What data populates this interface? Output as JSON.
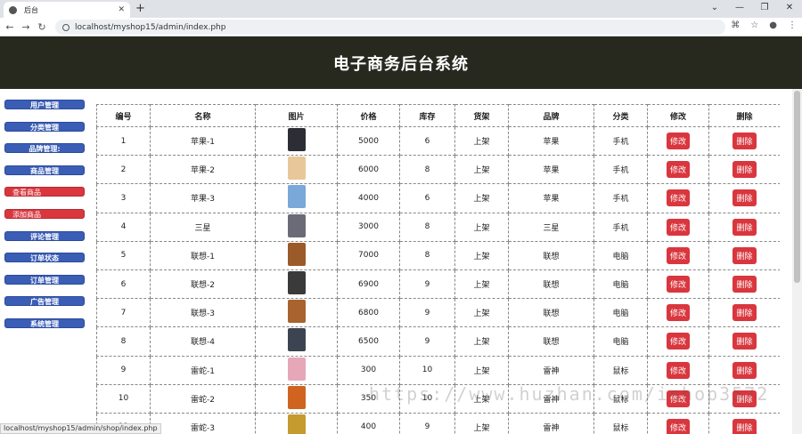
{
  "browser": {
    "tab_title": "后台",
    "url": "localhost/myshop15/admin/index.php",
    "status_url": "localhost/myshop15/admin/shop/index.php"
  },
  "header": {
    "title": "电子商务后台系统"
  },
  "sidebar": {
    "items": [
      {
        "label": "用户管理",
        "type": "main"
      },
      {
        "label": "分类管理",
        "type": "main"
      },
      {
        "label": "品牌管理:",
        "type": "main"
      },
      {
        "label": "商品管理",
        "type": "main"
      },
      {
        "label": "查看商品",
        "type": "sub"
      },
      {
        "label": "添加商品",
        "type": "sub"
      },
      {
        "label": "评论管理",
        "type": "main"
      },
      {
        "label": "订单状态",
        "type": "main"
      },
      {
        "label": "订单管理",
        "type": "main"
      },
      {
        "label": "广告管理",
        "type": "main"
      },
      {
        "label": "系统管理",
        "type": "main"
      }
    ]
  },
  "table": {
    "headers": [
      "编号",
      "名称",
      "图片",
      "价格",
      "库存",
      "货架",
      "品牌",
      "分类",
      "修改",
      "删除"
    ],
    "edit_label": "修改",
    "delete_label": "删除",
    "rows": [
      {
        "id": "1",
        "name": "苹果-1",
        "price": "5000",
        "stock": "6",
        "shelf": "上架",
        "brand": "苹果",
        "category": "手机",
        "thumb": "#2d2d35"
      },
      {
        "id": "2",
        "name": "苹果-2",
        "price": "6000",
        "stock": "8",
        "shelf": "上架",
        "brand": "苹果",
        "category": "手机",
        "thumb": "#e8c79a"
      },
      {
        "id": "3",
        "name": "苹果-3",
        "price": "4000",
        "stock": "6",
        "shelf": "上架",
        "brand": "苹果",
        "category": "手机",
        "thumb": "#7aa8d8"
      },
      {
        "id": "4",
        "name": "三星",
        "price": "3000",
        "stock": "8",
        "shelf": "上架",
        "brand": "三星",
        "category": "手机",
        "thumb": "#6b6b78"
      },
      {
        "id": "5",
        "name": "联想-1",
        "price": "7000",
        "stock": "8",
        "shelf": "上架",
        "brand": "联想",
        "category": "电脑",
        "thumb": "#9a5a2a"
      },
      {
        "id": "6",
        "name": "联想-2",
        "price": "6900",
        "stock": "9",
        "shelf": "上架",
        "brand": "联想",
        "category": "电脑",
        "thumb": "#3a3a3a"
      },
      {
        "id": "7",
        "name": "联想-3",
        "price": "6800",
        "stock": "9",
        "shelf": "上架",
        "brand": "联想",
        "category": "电脑",
        "thumb": "#a8632e"
      },
      {
        "id": "8",
        "name": "联想-4",
        "price": "6500",
        "stock": "9",
        "shelf": "上架",
        "brand": "联想",
        "category": "电脑",
        "thumb": "#3b4450"
      },
      {
        "id": "9",
        "name": "雷蛇-1",
        "price": "300",
        "stock": "10",
        "shelf": "上架",
        "brand": "雷神",
        "category": "鼠标",
        "thumb": "#e6a8b8"
      },
      {
        "id": "10",
        "name": "雷蛇-2",
        "price": "350",
        "stock": "10",
        "shelf": "上架",
        "brand": "雷神",
        "category": "鼠标",
        "thumb": "#d0631f"
      },
      {
        "id": "11",
        "name": "雷蛇-3",
        "price": "400",
        "stock": "9",
        "shelf": "上架",
        "brand": "雷神",
        "category": "鼠标",
        "thumb": "#c59a2e"
      }
    ]
  },
  "watermark": "https://www.huzhan.com/ishop3572"
}
